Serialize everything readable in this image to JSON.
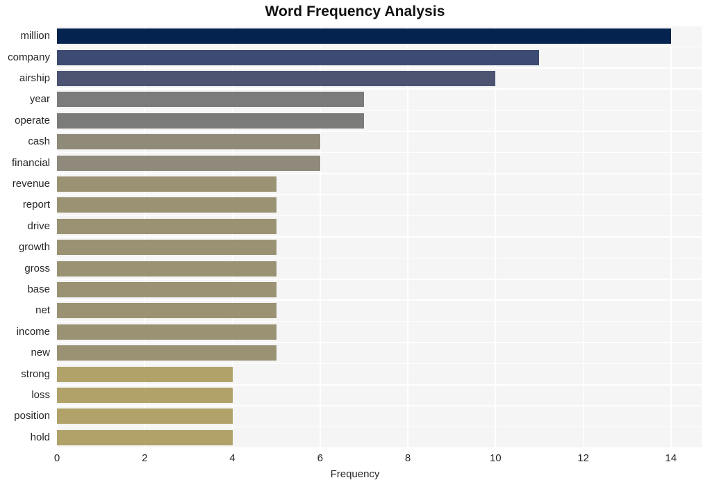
{
  "chart_data": {
    "type": "bar",
    "orientation": "horizontal",
    "title": "Word Frequency Analysis",
    "xlabel": "Frequency",
    "ylabel": "",
    "categories": [
      "million",
      "company",
      "airship",
      "year",
      "operate",
      "cash",
      "financial",
      "revenue",
      "report",
      "drive",
      "growth",
      "gross",
      "base",
      "net",
      "income",
      "new",
      "strong",
      "loss",
      "position",
      "hold"
    ],
    "values": [
      14,
      11,
      10,
      7,
      7,
      6,
      6,
      5,
      5,
      5,
      5,
      5,
      5,
      5,
      5,
      5,
      4,
      4,
      4,
      4
    ],
    "xlim": [
      0,
      14.7
    ],
    "xticks": [
      0,
      2,
      4,
      6,
      8,
      10,
      12,
      14
    ],
    "xticklabels": [
      "0",
      "2",
      "4",
      "6",
      "8",
      "10",
      "12",
      "14"
    ],
    "grid": true,
    "legend": false,
    "bar_colors": [
      "#04244f",
      "#3d4a72",
      "#4d5472",
      "#7b7b7b",
      "#7b7b79",
      "#908a79",
      "#8f8a7b",
      "#9a9273",
      "#9a9273",
      "#9a9273",
      "#9a9273",
      "#9a9273",
      "#9a9273",
      "#9a9273",
      "#9a9273",
      "#9a9273",
      "#b0a269",
      "#b0a269",
      "#b0a269",
      "#b0a269"
    ],
    "plot_background": "#f5f5f5",
    "grid_color": "#ffffff",
    "figure_background": "#ffffff"
  }
}
